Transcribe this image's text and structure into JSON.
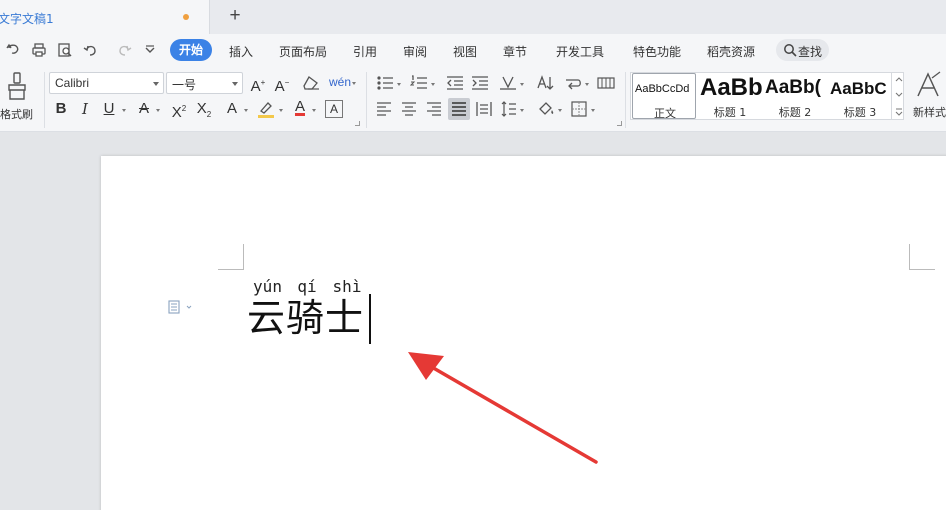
{
  "window": {
    "tab_title": "文字文稿1",
    "new_tab_icon": "plus-icon"
  },
  "menu": {
    "quick_icons": [
      "undo-history-icon",
      "print-icon",
      "print-preview-icon",
      "undo-icon",
      "redo-icon",
      "customize-dropdown-icon"
    ],
    "tabs": [
      "开始",
      "插入",
      "页面布局",
      "引用",
      "审阅",
      "视图",
      "章节",
      "开发工具",
      "特色功能",
      "稻壳资源"
    ],
    "active_tab": "开始",
    "search_label": "查找"
  },
  "toolbar": {
    "format_painter_label": "格式刷",
    "font_name": "Calibri",
    "font_size": "一号",
    "style_gallery": [
      {
        "preview": "AaBbCcDd",
        "name": "正文",
        "selected": true
      },
      {
        "preview": "AaBb",
        "name": "标题 1",
        "selected": false
      },
      {
        "preview": "AaBb(",
        "name": "标题 2",
        "selected": false
      },
      {
        "preview": "AaBbC",
        "name": "标题 3",
        "selected": false
      }
    ],
    "new_style_label": "新样式"
  },
  "document": {
    "pinyin": [
      "yún",
      "qí",
      "shì"
    ],
    "text": "云骑士",
    "accent_color": "#e53935"
  }
}
